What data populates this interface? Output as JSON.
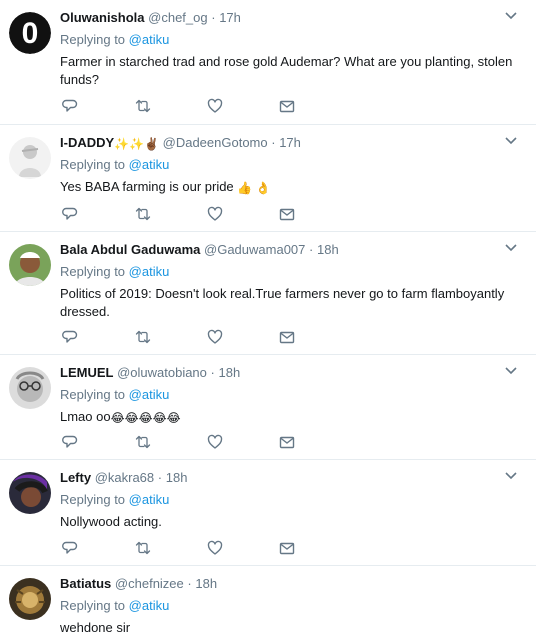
{
  "tweets": [
    {
      "fullname": "Oluwanishola",
      "username": "@chef_og",
      "time": "17h",
      "reply_prefix": "Replying to",
      "reply_to": "@atiku",
      "text": "Farmer in starched trad and rose gold Audemar? What are you planting, stolen funds?",
      "avatar_letter": "0"
    },
    {
      "fullname": "I-DADDY",
      "fullname_emoji": "✨✨✌🏾",
      "username": "@DadeenGotomo",
      "time": "17h",
      "reply_prefix": "Replying to",
      "reply_to": "@atiku",
      "text": "Yes BABA farming is our pride",
      "text_emoji": "👍 👌"
    },
    {
      "fullname": "Bala Abdul Gaduwama",
      "username": "@Gaduwama007",
      "time": "18h",
      "reply_prefix": "Replying to",
      "reply_to": "@atiku",
      "text": "Politics of 2019: Doesn't look real.True farmers never go to farm flamboyantly dressed."
    },
    {
      "fullname": "LEMUEL",
      "username": "@oluwatobiano",
      "time": "18h",
      "reply_prefix": "Replying to",
      "reply_to": "@atiku",
      "text": "Lmao oo",
      "text_emoji": "😂😂😂😂😂"
    },
    {
      "fullname": "Lefty",
      "username": "@kakra68",
      "time": "18h",
      "reply_prefix": "Replying to",
      "reply_to": "@atiku",
      "text": "Nollywood acting."
    },
    {
      "fullname": "Batiatus",
      "username": "@chefnizee",
      "time": "18h",
      "reply_prefix": "Replying to",
      "reply_to": "@atiku",
      "text": "wehdone sir"
    }
  ],
  "separator": "·",
  "icons": {
    "reply": "reply-icon",
    "retweet": "retweet-icon",
    "like": "like-icon",
    "dm": "direct-message-icon",
    "more": "chevron-down-icon"
  },
  "colors": {
    "link": "#1b95e0",
    "muted": "#657786",
    "text": "#14171a",
    "divider": "#e6ecf0"
  }
}
